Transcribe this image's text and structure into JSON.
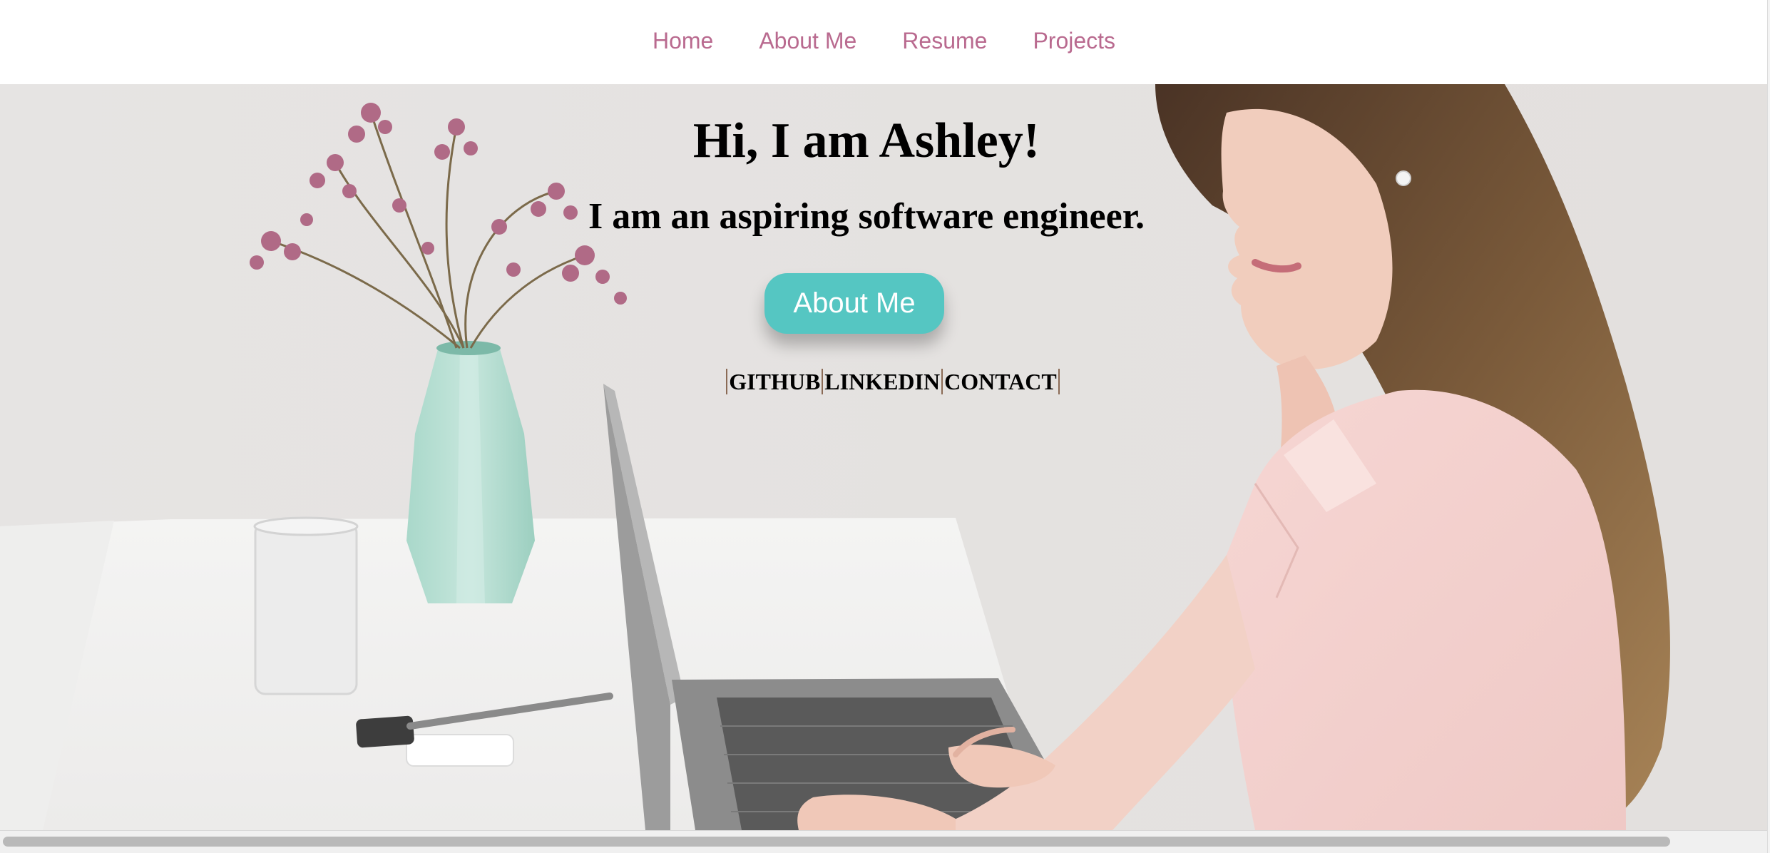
{
  "nav": {
    "items": [
      {
        "label": "Home"
      },
      {
        "label": "About Me"
      },
      {
        "label": "Resume"
      },
      {
        "label": "Projects"
      }
    ]
  },
  "hero": {
    "title": "Hi, I am Ashley!",
    "subtitle": "I am an aspiring software engineer.",
    "cta_label": "About Me",
    "social": [
      {
        "label": "GITHUB"
      },
      {
        "label": "LINKEDIN"
      },
      {
        "label": "CONTACT"
      }
    ]
  },
  "colors": {
    "nav_link": "#b96a8f",
    "cta_bg": "#55c6c2",
    "hero_bg": "#e9e7e6"
  }
}
